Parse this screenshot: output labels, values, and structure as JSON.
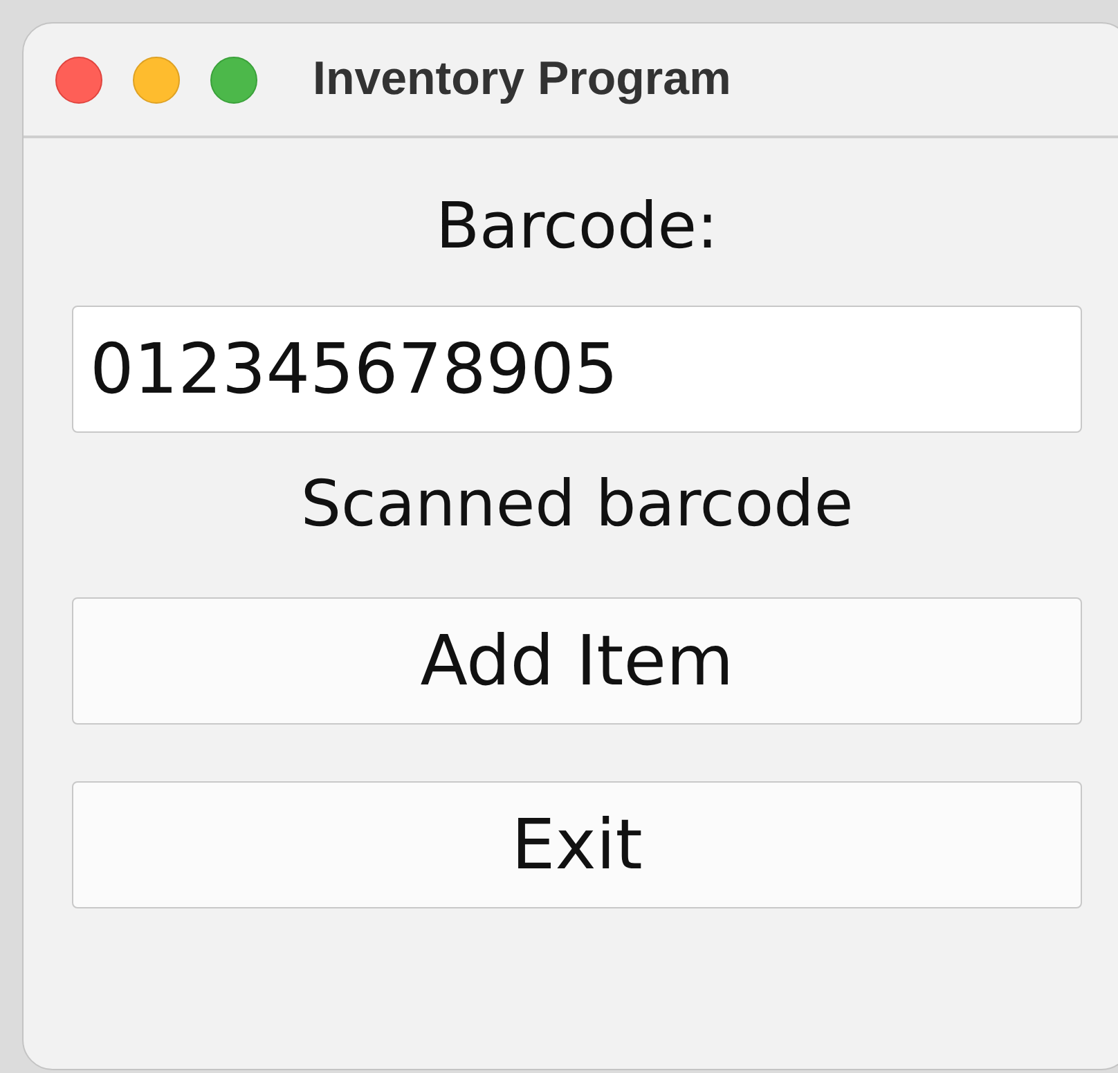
{
  "window": {
    "title": "Inventory Program"
  },
  "barcode_label": "Barcode:",
  "barcode_field": {
    "value": "012345678905"
  },
  "status": "Scanned barcode",
  "buttons": [
    "Add Item",
    "Exit"
  ]
}
